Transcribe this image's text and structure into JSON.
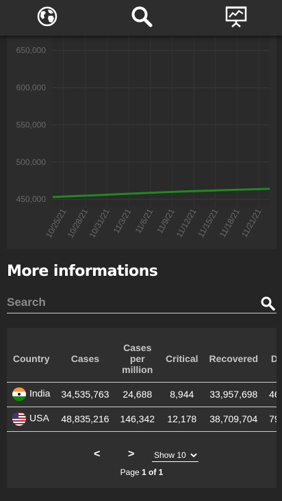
{
  "nav": {
    "items": [
      {
        "name": "globe-icon"
      },
      {
        "name": "search-icon"
      },
      {
        "name": "chart-presentation-icon"
      }
    ]
  },
  "chart_data": {
    "type": "line",
    "title": "",
    "xlabel": "",
    "ylabel": "",
    "x_ticks": [
      "10/25/21",
      "10/28/21",
      "10/31/21",
      "11/3/21",
      "11/6/21",
      "11/9/21",
      "11/12/21",
      "11/15/21",
      "11/18/21",
      "11/21/21"
    ],
    "y_ticks": [
      450000,
      500000,
      550000,
      600000,
      650000
    ],
    "y_tick_labels": [
      "450,000",
      "500,000",
      "550,000",
      "600,000",
      "650,000"
    ],
    "ylim": [
      440000,
      670000
    ],
    "grid": true,
    "series": [
      {
        "color": "#1e8a1e",
        "x": [
          "10/24/21",
          "10/27/21",
          "10/30/21",
          "11/2/21",
          "11/5/21",
          "11/8/21",
          "11/11/21",
          "11/14/21",
          "11/17/21",
          "11/20/21",
          "11/23/21"
        ],
        "values": [
          453000,
          454300,
          455500,
          456800,
          458000,
          459300,
          460400,
          461400,
          462300,
          463200,
          464000
        ]
      }
    ]
  },
  "section": {
    "title": "More informations"
  },
  "search": {
    "placeholder": "Search"
  },
  "table": {
    "headers": [
      "Country",
      "Cases",
      "Cases per million",
      "Critical",
      "Recovered",
      "D"
    ],
    "rows": [
      {
        "flag": "india-flag",
        "country": "India",
        "cases": "34,535,763",
        "per_million": "24,688",
        "critical": "8,944",
        "recovered": "33,957,698",
        "extra": "46"
      },
      {
        "flag": "usa-flag",
        "country": "USA",
        "cases": "48,835,216",
        "per_million": "146,342",
        "critical": "12,178",
        "recovered": "38,709,704",
        "extra": "79"
      }
    ]
  },
  "pager": {
    "prev": "<",
    "next": ">",
    "show_label": "Show 10",
    "page_prefix": "Page ",
    "page_current": "1 of 1"
  }
}
